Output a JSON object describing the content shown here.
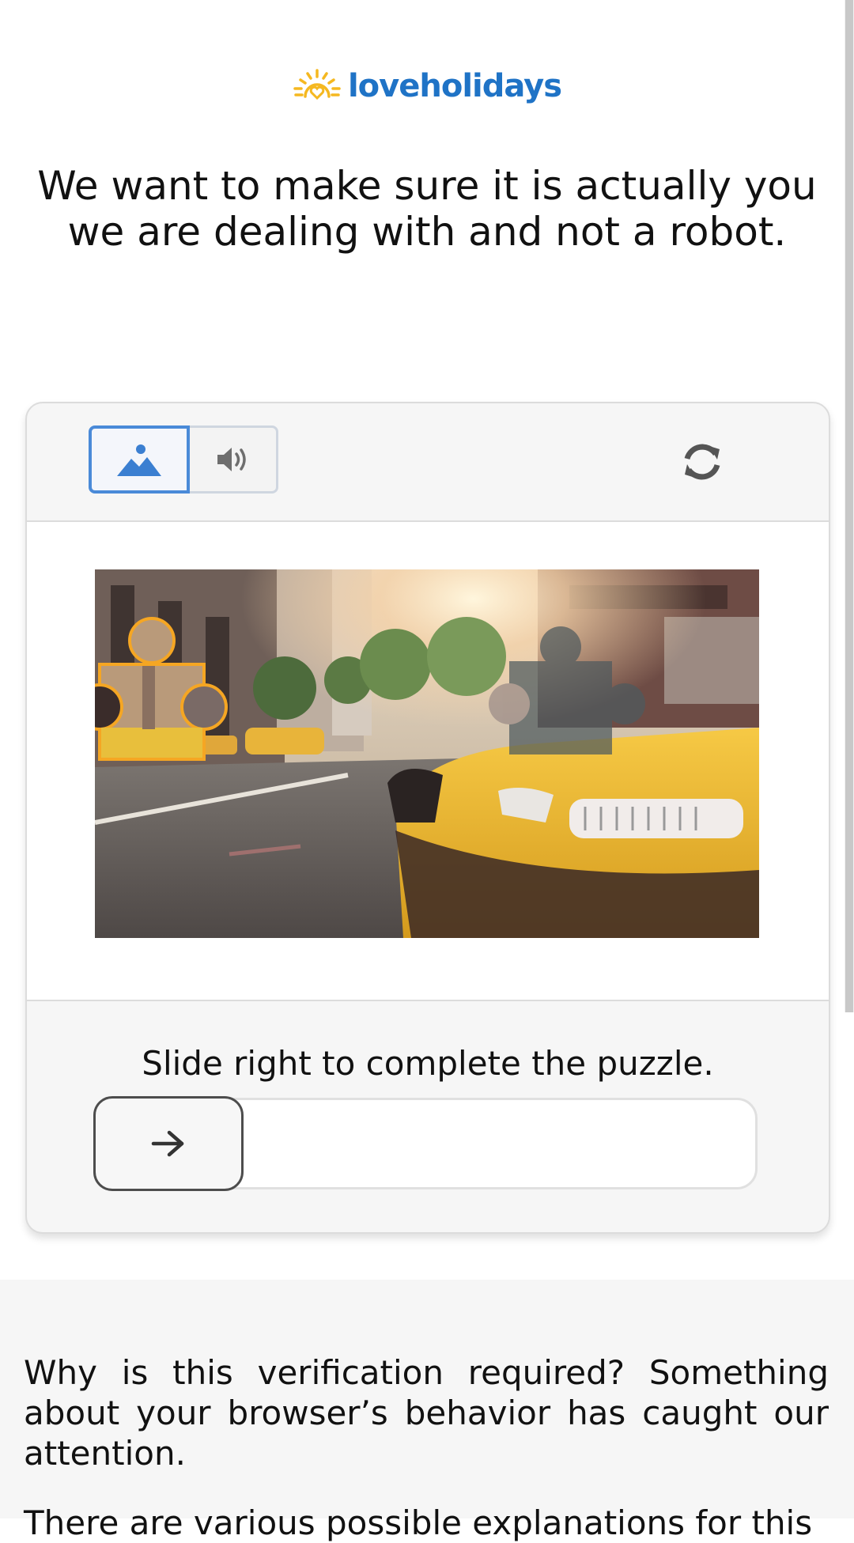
{
  "brand": {
    "name": "loveholidays",
    "color": "#1f73c6",
    "sun_color": "#f5b820"
  },
  "headline": "We want to make sure it is actually you we are dealing with and not a robot.",
  "captcha": {
    "modes": [
      {
        "name": "image",
        "icon": "image-mountain-icon",
        "selected": true
      },
      {
        "name": "audio",
        "icon": "speaker-icon",
        "selected": false
      }
    ],
    "refresh_icon": "refresh-icon",
    "instruction": "Slide right to complete the puzzle.",
    "slider_icon": "arrow-right-icon",
    "slider_progress": 0,
    "accent_color": "#4a8ad8",
    "puzzle_piece_color": "#f5a623"
  },
  "info": {
    "paragraph_1": "Why is this verification required? Something about your browser’s behavior has caught our attention.",
    "paragraph_2": "There are various possible explanations for this"
  }
}
